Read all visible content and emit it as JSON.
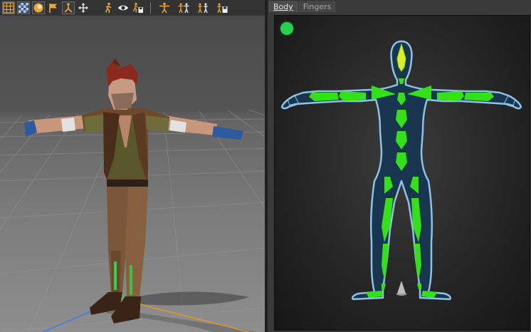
{
  "toolbar": {
    "tools": [
      {
        "icon": "grid-icon"
      },
      {
        "icon": "checker-icon"
      },
      {
        "icon": "sphere-icon"
      },
      {
        "icon": "flag-icon"
      },
      {
        "icon": "skeleton-axis-icon"
      },
      {
        "icon": "move-icon"
      },
      {
        "icon": "walk-icon"
      },
      {
        "icon": "eye-icon"
      },
      {
        "icon": "run-save-icon"
      },
      {
        "icon": "tpose-icon"
      },
      {
        "icon": "tpose-pair-icon"
      },
      {
        "icon": "pair-icon"
      },
      {
        "icon": "pair-save-icon"
      }
    ]
  },
  "right_panel": {
    "tabs": [
      {
        "label": "Body",
        "active": true
      },
      {
        "label": "Fingers",
        "active": false
      }
    ],
    "status_color": "#2ad14e"
  },
  "colors": {
    "bone_green": "#33e01a",
    "body_fill": "#18364f",
    "body_outline": "#8fc2e3",
    "bone_yellow": "#d8ee2a"
  }
}
